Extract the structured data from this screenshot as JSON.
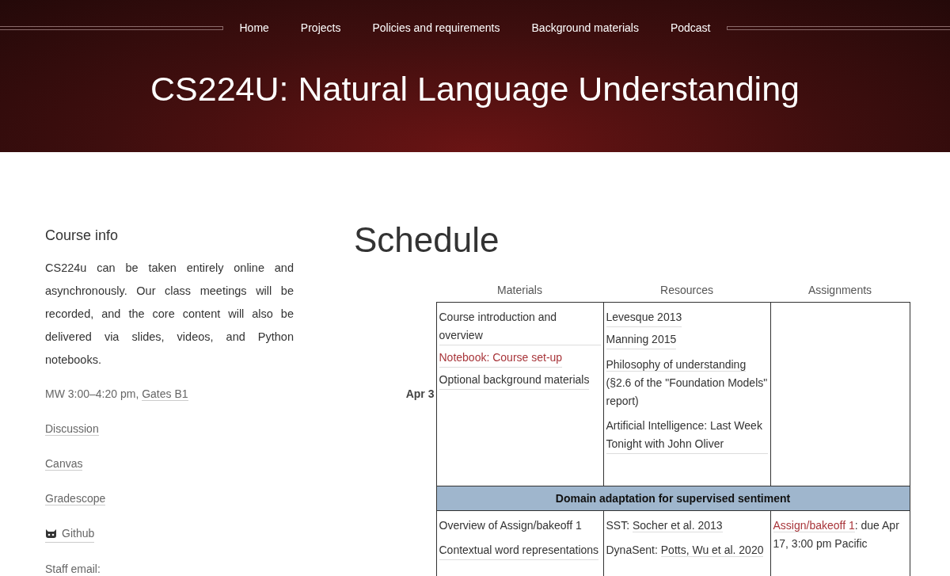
{
  "nav": {
    "items": [
      {
        "label": "Home"
      },
      {
        "label": "Projects"
      },
      {
        "label": "Policies and requirements"
      },
      {
        "label": "Background materials"
      },
      {
        "label": "Podcast"
      }
    ]
  },
  "title": "CS224U: Natural Language Understanding",
  "sidebar": {
    "heading": "Course info",
    "intro": "CS224u can be taken entirely online and asynchronously. Our class meetings will be recorded, and the core content will also be delivered via slides, videos, and Python notebooks.",
    "items": [
      {
        "kind": "meeting",
        "text": "MW 3:00–4:20 pm, ",
        "link": "Gates B1"
      },
      {
        "kind": "link",
        "link": "Discussion"
      },
      {
        "kind": "link",
        "link": "Canvas"
      },
      {
        "kind": "link",
        "link": "Gradescope"
      },
      {
        "kind": "github",
        "link": "Github"
      },
      {
        "kind": "text",
        "text": "Staff email:"
      }
    ]
  },
  "schedule": {
    "heading": "Schedule",
    "columns": [
      "Materials",
      "Resources",
      "Assignments"
    ],
    "rows": [
      {
        "kind": "week",
        "date": "Apr 3",
        "cells": [
          [
            [
              {
                "kind": "link",
                "text": "Course introduction and overview"
              }
            ],
            [
              {
                "kind": "accent",
                "text": "Notebook: Course set-up"
              }
            ],
            [
              {
                "kind": "link",
                "text": "Optional background materials"
              }
            ]
          ],
          [
            [
              {
                "kind": "link",
                "text": "Levesque 2013"
              }
            ],
            [
              {
                "kind": "link",
                "text": "Manning 2015"
              }
            ],
            [
              {
                "kind": "link",
                "text": "Philosophy of understanding"
              },
              {
                "kind": "text",
                "text": " (§2.6 of the \"Foundation Models\" report)"
              }
            ],
            [
              {
                "kind": "link",
                "text": "Artificial Intelligence: Last Week Tonight with John Oliver"
              }
            ]
          ],
          []
        ]
      },
      {
        "kind": "section",
        "title": "Domain adaptation for supervised sentiment"
      },
      {
        "kind": "week",
        "date": "",
        "cells": [
          [
            [
              {
                "kind": "text",
                "text": "Overview of Assign/bakeoff 1"
              }
            ],
            [
              {
                "kind": "link",
                "text": "Contextual word representations"
              }
            ]
          ],
          [
            [
              {
                "kind": "text",
                "text": "SST: "
              },
              {
                "kind": "link",
                "text": "Socher et al. 2013"
              }
            ],
            [
              {
                "kind": "text",
                "text": "DynaSent: "
              },
              {
                "kind": "link",
                "text": "Potts, Wu et al. 2020"
              }
            ]
          ],
          [
            [
              {
                "kind": "accent",
                "text": "Assign/bakeoff 1"
              },
              {
                "kind": "text",
                "text": ": due Apr 17, 3:00 pm Pacific"
              }
            ]
          ]
        ]
      }
    ]
  }
}
